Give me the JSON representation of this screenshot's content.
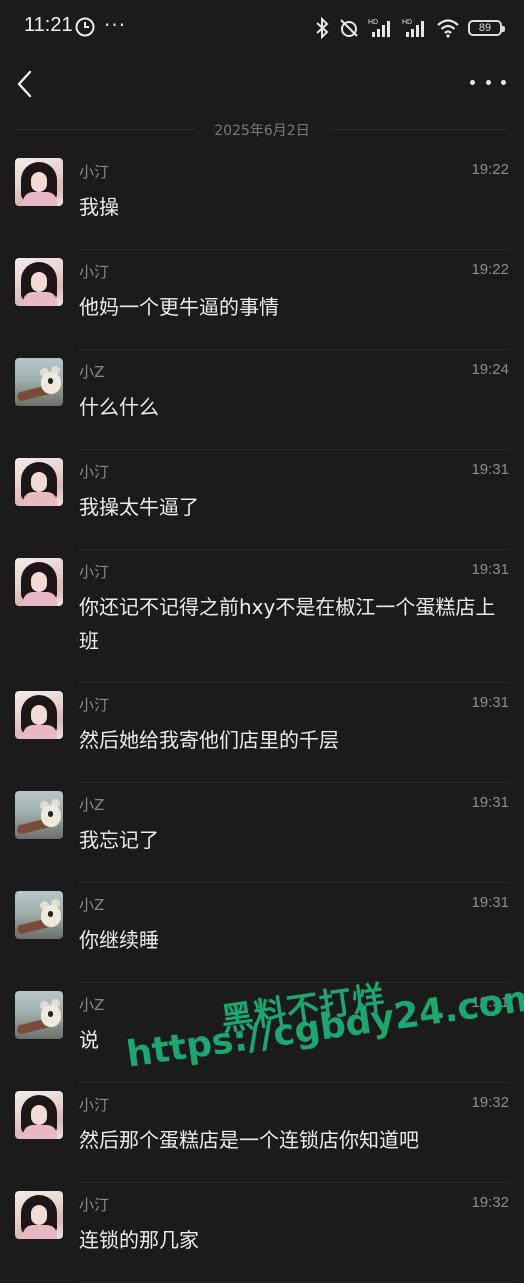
{
  "status_bar": {
    "time": "11:21",
    "dots": "···",
    "battery": "89"
  },
  "nav": {
    "back_icon": "chevron-left-icon",
    "more_icon": "more-horizontal-icon"
  },
  "date_divider": "2025年6月2日",
  "messages": [
    {
      "sender": "小汀",
      "avatar": "girl",
      "time": "19:22",
      "text": "我操"
    },
    {
      "sender": "小汀",
      "avatar": "girl",
      "time": "19:22",
      "text": "他妈一个更牛逼的事情"
    },
    {
      "sender": "小Z",
      "avatar": "dog",
      "time": "19:24",
      "text": "什么什么"
    },
    {
      "sender": "小汀",
      "avatar": "girl",
      "time": "19:31",
      "text": "我操太牛逼了"
    },
    {
      "sender": "小汀",
      "avatar": "girl",
      "time": "19:31",
      "text": "你还记不记得之前hxy不是在椒江一个蛋糕店上班"
    },
    {
      "sender": "小汀",
      "avatar": "girl",
      "time": "19:31",
      "text": "然后她给我寄他们店里的千层"
    },
    {
      "sender": "小Z",
      "avatar": "dog",
      "time": "19:31",
      "text": "我忘记了"
    },
    {
      "sender": "小Z",
      "avatar": "dog",
      "time": "19:31",
      "text": "你继续睡"
    },
    {
      "sender": "小Z",
      "avatar": "dog",
      "time": "19:31",
      "text": "说"
    },
    {
      "sender": "小汀",
      "avatar": "girl",
      "time": "19:32",
      "text": "然后那个蛋糕店是一个连锁店你知道吧"
    },
    {
      "sender": "小汀",
      "avatar": "girl",
      "time": "19:32",
      "text": "连锁的那几家"
    }
  ],
  "watermark": {
    "line1": "黑料不打烊",
    "line2": "https://cgbdy24.com",
    "color": "#1ea672"
  }
}
